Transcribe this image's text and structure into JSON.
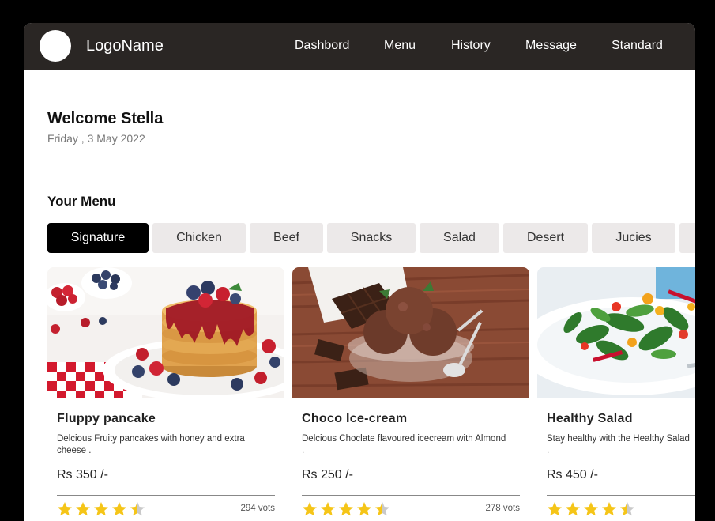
{
  "brand": {
    "logo_text": "LogoName"
  },
  "nav": [
    {
      "label": "Dashbord"
    },
    {
      "label": "Menu"
    },
    {
      "label": "History"
    },
    {
      "label": "Message"
    },
    {
      "label": "Standard"
    }
  ],
  "greeting": {
    "title": "Welcome Stella",
    "date": "Friday , 3 May 2022"
  },
  "menu": {
    "title": "Your Menu",
    "tabs": [
      {
        "label": "Signature",
        "active": true
      },
      {
        "label": "Chicken"
      },
      {
        "label": "Beef"
      },
      {
        "label": "Snacks"
      },
      {
        "label": "Salad"
      },
      {
        "label": "Desert"
      },
      {
        "label": "Jucies"
      }
    ]
  },
  "cards": [
    {
      "title": "Fluppy pancake",
      "desc": "Delcious Fruity pancakes with honey and extra cheese .",
      "price": "Rs 350 /-",
      "rating": 4.5,
      "votes": "294 vots",
      "image": "pancake-photo"
    },
    {
      "title": "Choco Ice-cream",
      "desc": "Delcious Choclate flavoured icecream with Almond",
      "desc_tail": ".",
      "price": "Rs 250 /-",
      "rating": 4.5,
      "votes": "278 vots",
      "image": "ice-cream-photo"
    },
    {
      "title": "Healthy Salad",
      "desc": "Stay healthy with the Healthy Salad",
      "desc_tail": ".",
      "price": "Rs 450 /-",
      "rating": 4.5,
      "votes": "",
      "image": "salad-photo"
    }
  ],
  "colors": {
    "topbar": "#2a2624",
    "tab_bg": "#ece9e9",
    "tab_active": "#000000",
    "star": "#f5c518"
  }
}
